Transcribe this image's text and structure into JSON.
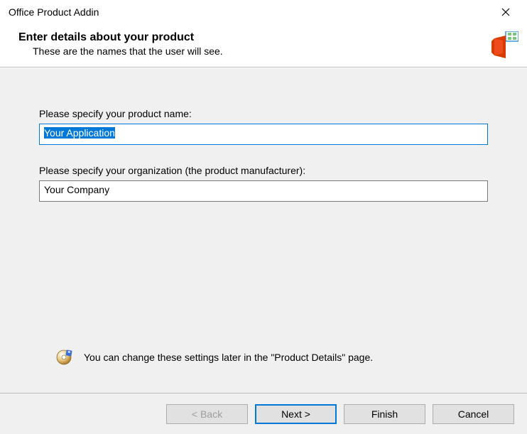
{
  "titlebar": {
    "title": "Office Product Addin"
  },
  "header": {
    "heading": "Enter details about your product",
    "subheading": "These are the names that the user will see."
  },
  "form": {
    "product_name_label": "Please specify your product name:",
    "product_name_value": "Your Application",
    "organization_label": "Please specify your organization (the product manufacturer):",
    "organization_value": "Your Company"
  },
  "info": {
    "text": "You can change these settings later in the \"Product Details\" page."
  },
  "buttons": {
    "back": "< Back",
    "next": "Next >",
    "finish": "Finish",
    "cancel": "Cancel"
  }
}
